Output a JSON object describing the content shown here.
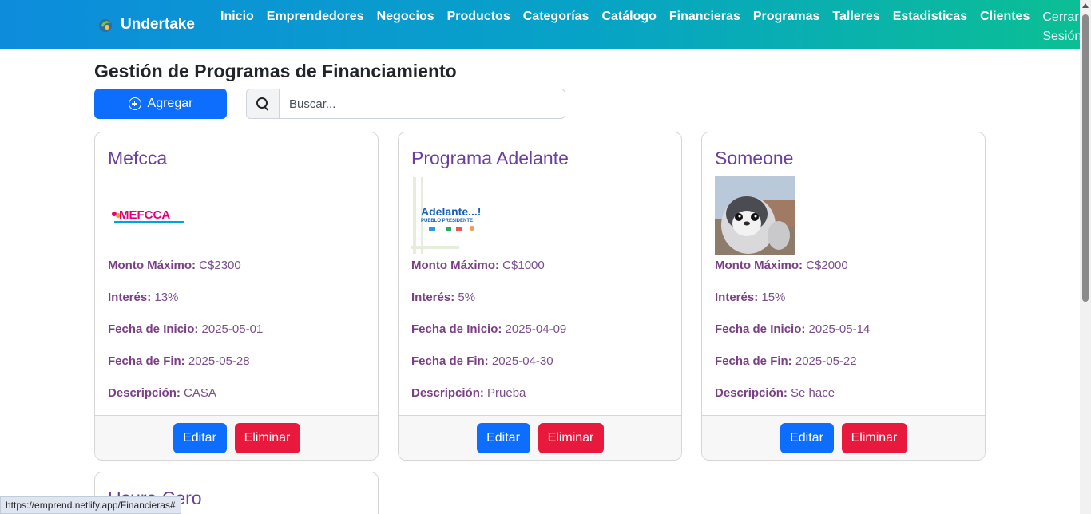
{
  "brand": {
    "name": "Undertake"
  },
  "nav": {
    "links": [
      "Inicio",
      "Emprendedores",
      "Negocios",
      "Productos",
      "Categorías",
      "Catálogo",
      "Financieras",
      "Programas",
      "Talleres",
      "Estadisticas",
      "Clientes"
    ],
    "logout": "Cerrar Sesión"
  },
  "page": {
    "title": "Gestión de Programas de Financiamiento"
  },
  "toolbar": {
    "add_label": "Agregar",
    "search_placeholder": "Buscar..."
  },
  "labels": {
    "monto": "Monto Máximo:",
    "interes": "Interés:",
    "inicio": "Fecha de Inicio:",
    "fin": "Fecha de Fin:",
    "descripcion": "Descripción:",
    "edit": "Editar",
    "delete": "Eliminar"
  },
  "cards": [
    {
      "title": "Mefcca",
      "image_text": "MEFCCA",
      "monto": "C$2300",
      "interes": "13%",
      "inicio": "2025-05-01",
      "fin": "2025-05-28",
      "descripcion": "CASA"
    },
    {
      "title": "Programa Adelante",
      "image_text": "Adelante...!",
      "image_subtext": "PUEBLO PRESIDENTE",
      "monto": "C$1000",
      "interes": "5%",
      "inicio": "2025-04-09",
      "fin": "2025-04-30",
      "descripcion": "Prueba"
    },
    {
      "title": "Someone",
      "monto": "C$2000",
      "interes": "15%",
      "inicio": "2025-05-14",
      "fin": "2025-05-22",
      "descripcion": "Se hace"
    },
    {
      "title": "Usura Cero"
    }
  ],
  "status_url": "https://emprend.netlify.app/Financieras#",
  "colors": {
    "primary": "#0d6efd",
    "danger": "#e8193c",
    "title_purple": "#6b3fa0"
  }
}
